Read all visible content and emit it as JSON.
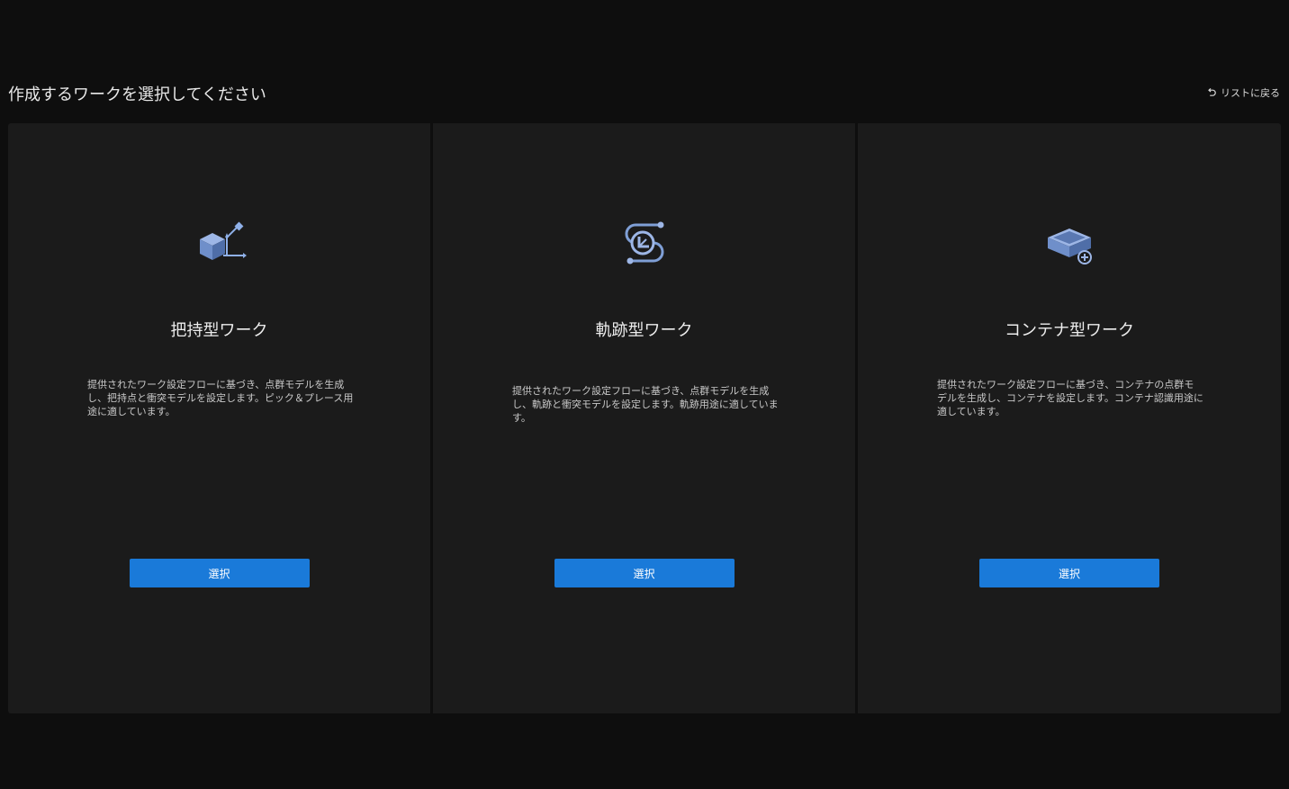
{
  "header": {
    "title": "作成するワークを選択してください",
    "back_label": "リストに戻る",
    "back_icon": "undo-arrow-icon"
  },
  "cards": [
    {
      "icon": "cube-with-axes-icon",
      "title": "把持型ワーク",
      "description": "提供されたワーク設定フローに基づき、点群モデルを生成し、把持点と衝突モデルを設定します。ピック＆プレース用途に適しています。",
      "button_label": "選択"
    },
    {
      "icon": "path-trajectory-icon",
      "title": "軌跡型ワーク",
      "description": "提供されたワーク設定フローに基づき、点群モデルを生成し、軌跡と衝突モデルを設定します。軌跡用途に適しています。",
      "button_label": "選択"
    },
    {
      "icon": "container-add-icon",
      "title": "コンテナ型ワーク",
      "description": "提供されたワーク設定フローに基づき、コンテナの点群モデルを生成し、コンテナを設定します。コンテナ認識用途に適しています。",
      "button_label": "選択"
    }
  ],
  "colors": {
    "background": "#0e0e0e",
    "card_background": "#1b1b1b",
    "accent": "#1a7ad9",
    "icon_fill": "#7f9fd6"
  }
}
